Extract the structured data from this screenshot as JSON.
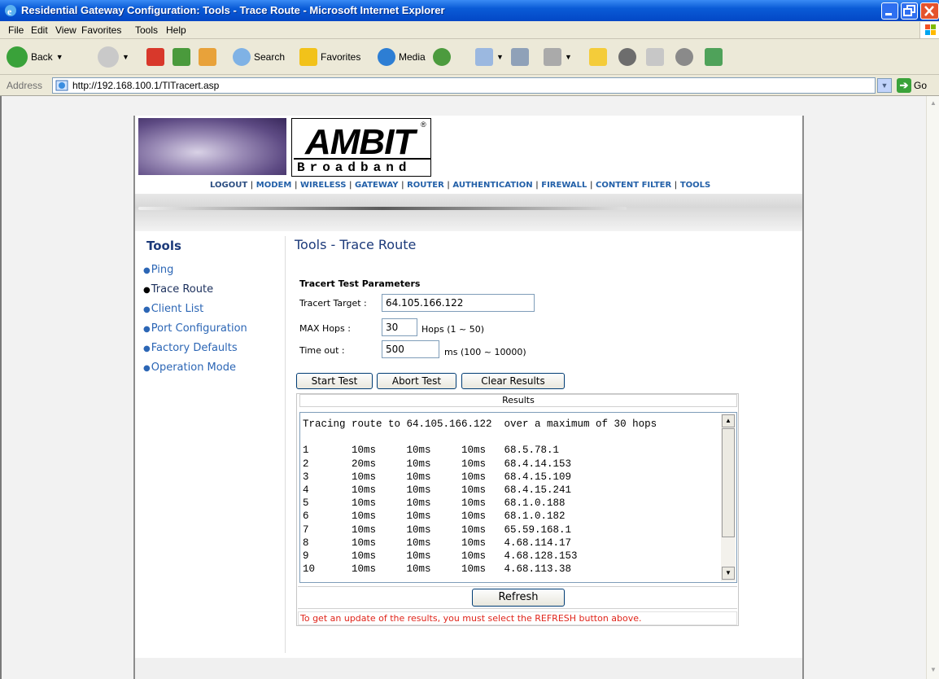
{
  "window": {
    "title": "Residential Gateway Configuration: Tools - Trace Route - Microsoft Internet Explorer"
  },
  "menu": [
    "File",
    "Edit",
    "View",
    "Favorites",
    "Tools",
    "Help"
  ],
  "toolbar": {
    "back": "Back",
    "search": "Search",
    "favorites": "Favorites",
    "media": "Media"
  },
  "address": {
    "label": "Address",
    "url": "http://192.168.100.1/TlTracert.asp",
    "go": "Go"
  },
  "logo": {
    "brand": "AMBIT",
    "registered": "®",
    "sub": "Broadband"
  },
  "topnav": [
    "LOGOUT",
    "MODEM",
    "WIRELESS",
    "GATEWAY",
    "ROUTER",
    "AUTHENTICATION",
    "FIREWALL",
    "CONTENT FILTER",
    "TOOLS"
  ],
  "sidebar": {
    "title": "Tools",
    "items": [
      "Ping",
      "Trace Route",
      "Client List",
      "Port Configuration",
      "Factory Defaults",
      "Operation Mode"
    ]
  },
  "main": {
    "title": "Tools - Trace Route",
    "section": "Tracert Test Parameters",
    "target_label": "Tracert Target :",
    "target_value": "64.105.166.122",
    "hops_label": "MAX Hops :",
    "hops_value": "30",
    "hops_unit": "Hops (1 ~ 50)",
    "timeout_label": "Time out :",
    "timeout_value": "500",
    "timeout_unit": "ms (100 ~ 10000)",
    "start_button": "Start Test",
    "abort_button": "Abort Test",
    "clear_button": "Clear Results",
    "results_header": "Results",
    "results_text": "Tracing route to 64.105.166.122  over a maximum of 30 hops\n\n1       10ms     10ms     10ms   68.5.78.1\n2       20ms     10ms     10ms   68.4.14.153\n3       10ms     10ms     10ms   68.4.15.109\n4       10ms     10ms     10ms   68.4.15.241\n5       10ms     10ms     10ms   68.1.0.188\n6       10ms     10ms     10ms   68.1.0.182\n7       10ms     10ms     10ms   65.59.168.1\n8       10ms     10ms     10ms   4.68.114.17\n9       10ms     10ms     10ms   4.68.128.153\n10      10ms     10ms     10ms   4.68.113.38",
    "refresh_button": "Refresh",
    "note": "To get an update of the results, you must select the REFRESH button above."
  }
}
